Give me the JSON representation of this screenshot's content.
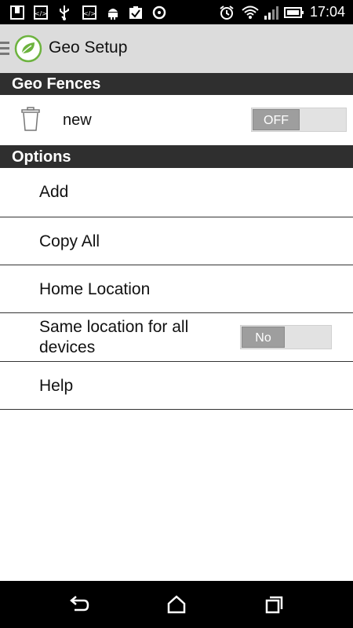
{
  "status_bar": {
    "time": "17:04",
    "icons": [
      "notification-icon",
      "code-icon",
      "usb-icon",
      "code-icon",
      "android-debug-icon",
      "clipboard-check-icon",
      "sync-icon",
      "alarm-icon",
      "wifi-icon",
      "signal-icon",
      "battery-icon"
    ]
  },
  "action_bar": {
    "title": "Geo Setup",
    "menu_icon": "menu-icon",
    "logo_icon": "leaf-logo-icon"
  },
  "geo_fences": {
    "header": "Geo Fences",
    "items": [
      {
        "name": "new",
        "toggle_label": "OFF",
        "toggle_state": "off",
        "icon": "trash-icon"
      }
    ]
  },
  "options": {
    "header": "Options",
    "items": [
      {
        "label": "Add"
      },
      {
        "label": "Copy All"
      },
      {
        "label": "Home Location"
      },
      {
        "label": "Same location for all devices",
        "toggle_label": "No",
        "toggle_state": "off"
      },
      {
        "label": "Help"
      }
    ]
  },
  "nav_bar": {
    "icons": [
      "back-icon",
      "home-icon",
      "recents-icon"
    ]
  },
  "colors": {
    "status_bar": "#000000",
    "action_bar": "#dcdcdc",
    "section_header": "#2f2f2f",
    "toggle_knob": "#9e9e9e",
    "toggle_track": "#e2e2e2",
    "logo_green": "#6db33f"
  }
}
